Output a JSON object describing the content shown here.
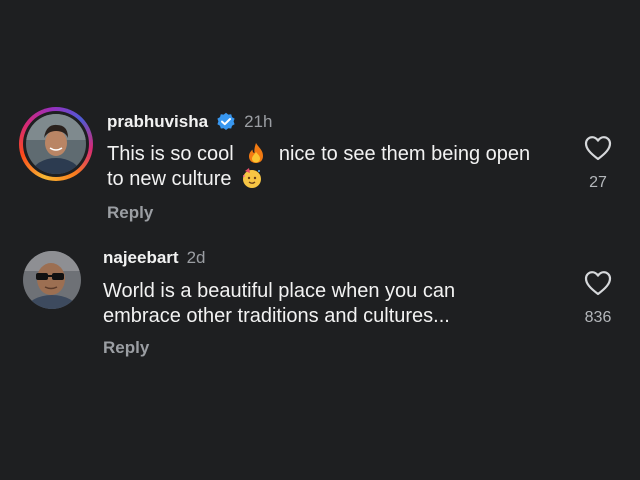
{
  "comments": [
    {
      "username": "prabhuvisha",
      "time": "21h",
      "verified": true,
      "text_line1": "This is so cool",
      "text_line1b": "nice to see them being open",
      "text_line2": "to new culture",
      "reply_label": "Reply",
      "like_count": "27",
      "icons": [
        "verified-badge-icon",
        "fire-emoji-icon",
        "party-face-emoji-icon",
        "heart-icon"
      ]
    },
    {
      "username": "najeebart",
      "time": "2d",
      "verified": false,
      "text_line1": "World is a beautiful place when you can",
      "text_line2": "embrace other traditions and cultures...",
      "reply_label": "Reply",
      "like_count": "836",
      "icons": [
        "heart-icon"
      ]
    }
  ],
  "colors": {
    "background": "#1e1f21",
    "text": "#f2f2f2",
    "muted": "#9b9ea3",
    "verified": "#3897f0"
  }
}
